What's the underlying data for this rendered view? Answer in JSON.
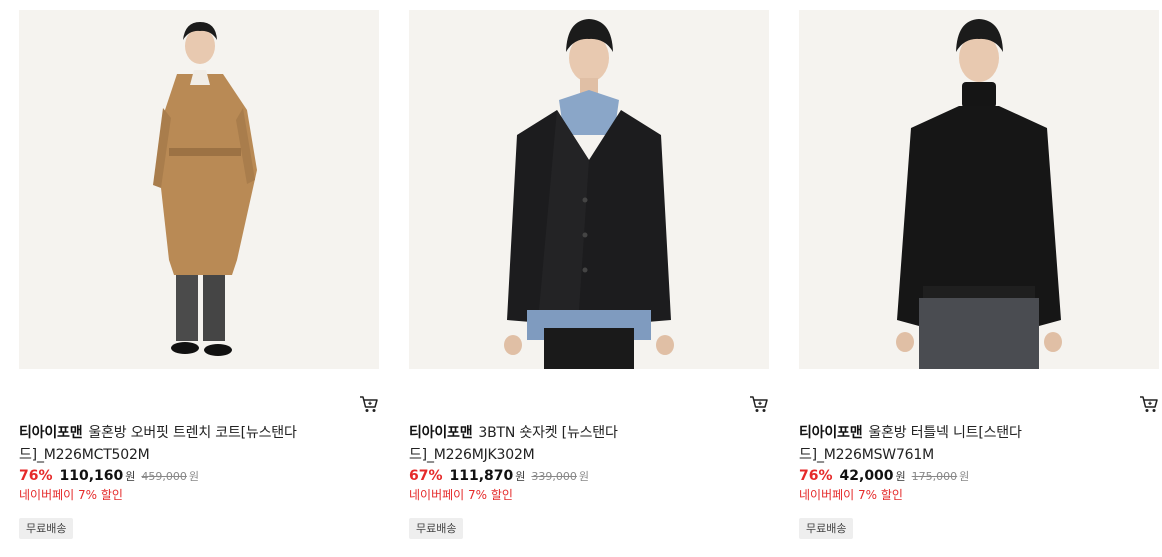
{
  "products": [
    {
      "image_icon": "model-wearing-camel-trench-coat",
      "brand": "티아이포맨",
      "name": "울혼방 오버핏 트렌치 코트[뉴스탠다드]_M226MCT502M",
      "discount_rate": "76%",
      "sale_price": "110,160",
      "currency": "원",
      "original_price": "459,000",
      "original_currency": "원",
      "npay_discount": "네이버페이 7% 할인",
      "shipping_badge": "무료배송"
    },
    {
      "image_icon": "model-wearing-black-jacket",
      "brand": "티아이포맨",
      "name": "3BTN 숏자켓 [뉴스탠다드]_M226MJK302M",
      "discount_rate": "67%",
      "sale_price": "111,870",
      "currency": "원",
      "original_price": "339,000",
      "original_currency": "원",
      "npay_discount": "네이버페이 7% 할인",
      "shipping_badge": "무료배송"
    },
    {
      "image_icon": "model-wearing-black-turtleneck-knit",
      "brand": "티아이포맨",
      "name": "울혼방 터틀넥 니트[스탠다드]_M226MSW761M",
      "discount_rate": "76%",
      "sale_price": "42,000",
      "currency": "원",
      "original_price": "175,000",
      "original_currency": "원",
      "npay_discount": "네이버페이 7% 할인",
      "shipping_badge": "무료배송"
    }
  ],
  "icons": {
    "cart": "shopping-cart-icon"
  },
  "colors": {
    "discount_red": "#e52a2a",
    "badge_bg": "#eeeeee",
    "photo_bg": "#f4f2ee"
  }
}
